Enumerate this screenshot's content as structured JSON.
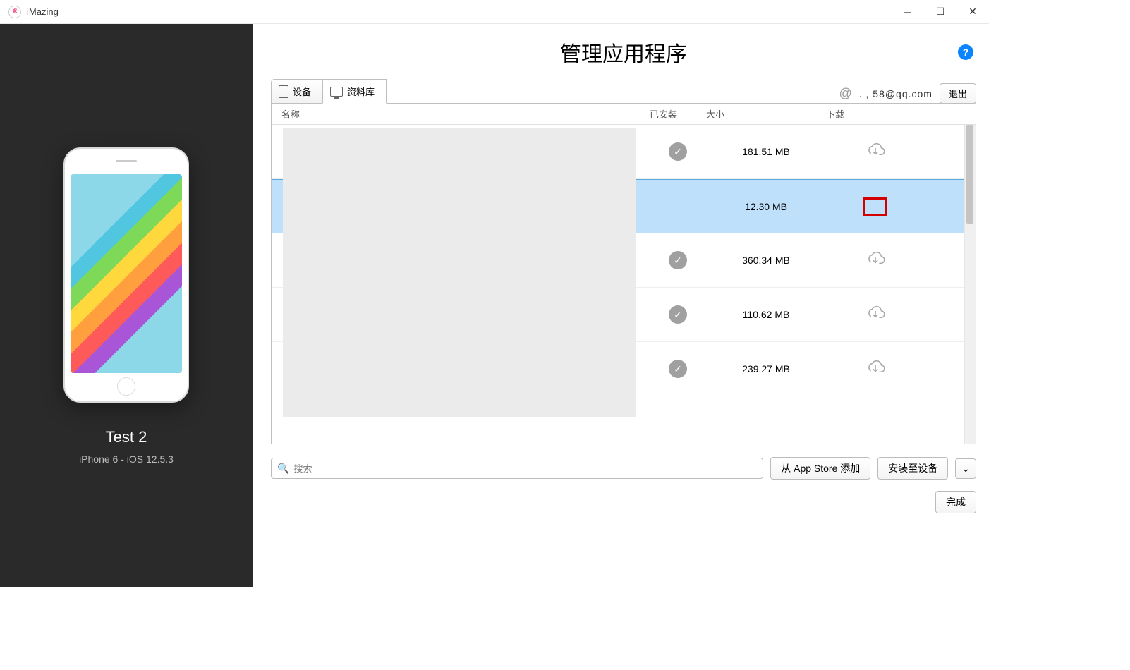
{
  "app": {
    "title": "iMazing"
  },
  "window_controls": {
    "min": "─",
    "max": "☐",
    "close": "✕"
  },
  "sidebar": {
    "device_name": "Test 2",
    "device_info": "iPhone 6 - iOS 12.5.3"
  },
  "header": {
    "title": "管理应用程序"
  },
  "tabs": {
    "device": "设备",
    "library": "资料库"
  },
  "account": {
    "email": "  .  ,  58@qq.com",
    "logout": "退出"
  },
  "table": {
    "columns": {
      "name": "名称",
      "installed": "已安装",
      "size": "大小",
      "download": "下载"
    },
    "rows": [
      {
        "installed": true,
        "size": "181.51 MB"
      },
      {
        "installed": false,
        "size": "12.30 MB",
        "selected": true,
        "highlight_download": true
      },
      {
        "installed": true,
        "size": "360.34 MB"
      },
      {
        "installed": true,
        "size": "110.62 MB"
      },
      {
        "installed": true,
        "size": "239.27 MB"
      }
    ]
  },
  "bottom": {
    "search_placeholder": "搜索",
    "add_from_store": "从 App Store 添加",
    "install_to_device": "安装至设备",
    "dropdown": "⌄"
  },
  "footer": {
    "done": "完成"
  }
}
